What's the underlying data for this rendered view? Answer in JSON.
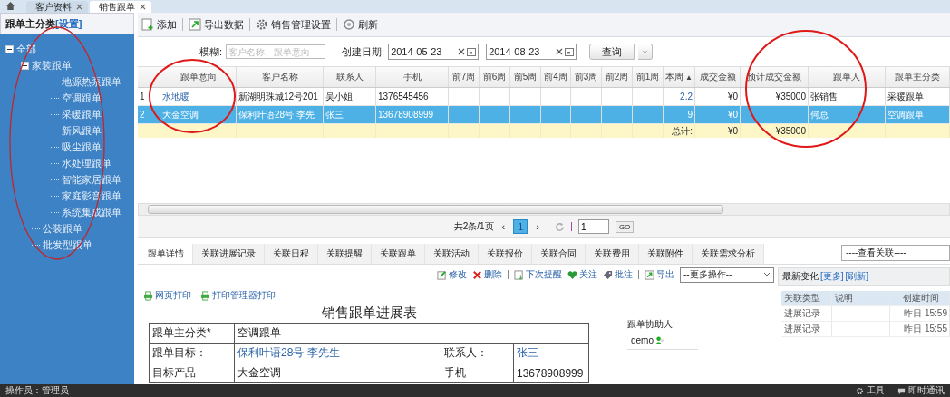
{
  "tabs": [
    {
      "label": "客户资料",
      "selected": false
    },
    {
      "label": "销售跟单",
      "selected": true
    }
  ],
  "sidebar": {
    "title": "跟单主分类",
    "link": "[设置]",
    "tree": [
      {
        "label": "全部",
        "expanded": true,
        "children": [
          {
            "label": "家装跟单",
            "expanded": true,
            "children": [
              {
                "label": "地源热泵跟单"
              },
              {
                "label": "空调跟单"
              },
              {
                "label": "采暖跟单"
              },
              {
                "label": "新风跟单"
              },
              {
                "label": "吸尘跟单"
              },
              {
                "label": "水处理跟单"
              },
              {
                "label": "智能家居跟单"
              },
              {
                "label": "家庭影音跟单"
              },
              {
                "label": "系统集成跟单"
              }
            ]
          },
          {
            "label": "公装跟单"
          },
          {
            "label": "批发型跟单"
          }
        ]
      }
    ]
  },
  "toolbar": [
    {
      "label": "添加"
    },
    {
      "label": "导出数据"
    },
    {
      "label": "销售管理设置"
    },
    {
      "label": "刷新"
    }
  ],
  "filter": {
    "search": {
      "label": "模糊:",
      "placeholder": "客户名称、跟单意向"
    },
    "date_label": "创建日期:",
    "date_from": "2014-05-23",
    "date_to": "2014-08-23",
    "query_button": "查询"
  },
  "table": {
    "columns": [
      {
        "label": "跟单意向"
      },
      {
        "label": "客户名称"
      },
      {
        "label": "联系人"
      },
      {
        "label": "手机"
      },
      {
        "label": "前7周"
      },
      {
        "label": "前6周"
      },
      {
        "label": "前5周"
      },
      {
        "label": "前4周"
      },
      {
        "label": "前3周"
      },
      {
        "label": "前2周"
      },
      {
        "label": "前1周"
      },
      {
        "label": "本周",
        "sort_mark": "▲"
      },
      {
        "label": "成交金额"
      },
      {
        "label": "预计成交金额"
      },
      {
        "label": "跟单人"
      },
      {
        "label": "跟单主分类"
      }
    ],
    "rows": [
      {
        "selected": false,
        "num": "1",
        "intent": "水地暖",
        "customer": "新湖明珠城12号201",
        "contact": "吴小姐",
        "phone": "1376545456",
        "this_week": "2.2",
        "deal": "¥0",
        "expected": "¥35000",
        "owner": "张销售",
        "category": "采暖跟单"
      },
      {
        "selected": true,
        "num": "2",
        "intent": "大金空调",
        "customer": "保利叶语28号 李先",
        "contact": "张三",
        "phone": "13678908999",
        "this_week": "9",
        "deal": "¥0",
        "owner": "何总",
        "category": "空调跟单"
      }
    ],
    "total": {
      "label": "总计:",
      "deal": "¥0",
      "expected": "¥35000"
    }
  },
  "pager": {
    "summary": "共2条/1页",
    "prev": "‹",
    "page": "1",
    "next": "›",
    "page_input": "1",
    "go": "GO"
  },
  "detail_tabs": [
    {
      "label": "跟单详情",
      "selected": true
    },
    {
      "label": "关联进展记录",
      "selected": false
    },
    {
      "label": "关联日程",
      "selected": false
    },
    {
      "label": "关联提醒",
      "selected": false
    },
    {
      "label": "关联跟单",
      "selected": false
    },
    {
      "label": "关联活动",
      "selected": false
    },
    {
      "label": "关联报价",
      "selected": false
    },
    {
      "label": "关联合同",
      "selected": false
    },
    {
      "label": "关联费用",
      "selected": false
    },
    {
      "label": "关联附件",
      "selected": false
    },
    {
      "label": "关联需求分析",
      "selected": false
    }
  ],
  "related_select": "----查看关联----",
  "actions": [
    [
      "修改",
      "删除"
    ],
    [
      "下次提醒",
      "关注",
      "批注"
    ],
    [
      "导出"
    ]
  ],
  "more_select": "--更多操作--",
  "print_links": [
    "网页打印",
    "打印管理器打印"
  ],
  "form": {
    "title": "销售跟单进展表",
    "rows": [
      {
        "label": "跟单主分类*",
        "value": "空调跟单",
        "link": false
      },
      {
        "label": "跟单目标：",
        "value": "保利叶语28号  李先生",
        "link": true,
        "label2": "联系人：",
        "value2": "张三",
        "link2": true
      },
      {
        "label": "目标产品",
        "value": "大金空调",
        "link": false,
        "label2": "手机",
        "value2": "13678908999",
        "link2": false
      }
    ]
  },
  "helpers": {
    "label": "跟单协助人:",
    "names": [
      "demo"
    ]
  },
  "recent": {
    "title": "最新变化",
    "links": [
      "[更多]",
      "[刷新]"
    ],
    "columns": [
      "关联类型",
      "说明",
      "创建时间"
    ],
    "rows": [
      {
        "type": "进展记录",
        "time": "昨日 15:59"
      },
      {
        "type": "进展记录",
        "time": "昨日 15:55"
      }
    ]
  },
  "status_bar": {
    "operator": "操作员：管理员",
    "items": [
      "工具",
      "即时通讯"
    ]
  }
}
